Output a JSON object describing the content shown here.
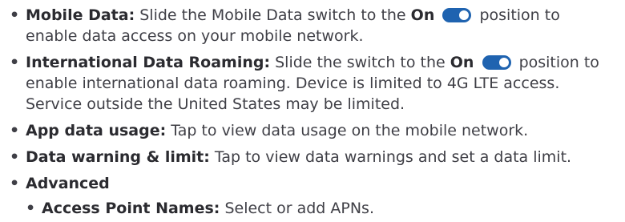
{
  "bullet": "•",
  "toggle_color": "#1f63b0",
  "items": [
    {
      "label": "Mobile Data:",
      "text_before": "Slide the Mobile Data switch to the",
      "on": "On",
      "text_after": "position to",
      "line2": "enable data access on your mobile network."
    },
    {
      "label": "International Data Roaming:",
      "text_before": "Slide the switch to the",
      "on": "On",
      "text_after": "position to",
      "line2": "enable international data roaming. Device is limited to 4G LTE access.",
      "line3": "Service outside the United States may be limited."
    },
    {
      "label": "App data usage:",
      "text": "Tap to view data usage on the mobile network."
    },
    {
      "label": "Data warning & limit:",
      "text": "Tap to view data warnings and set a data limit."
    },
    {
      "label": "Advanced"
    }
  ],
  "sub_items": [
    {
      "label": "Access Point Names:",
      "text": "Select or add APNs."
    }
  ]
}
